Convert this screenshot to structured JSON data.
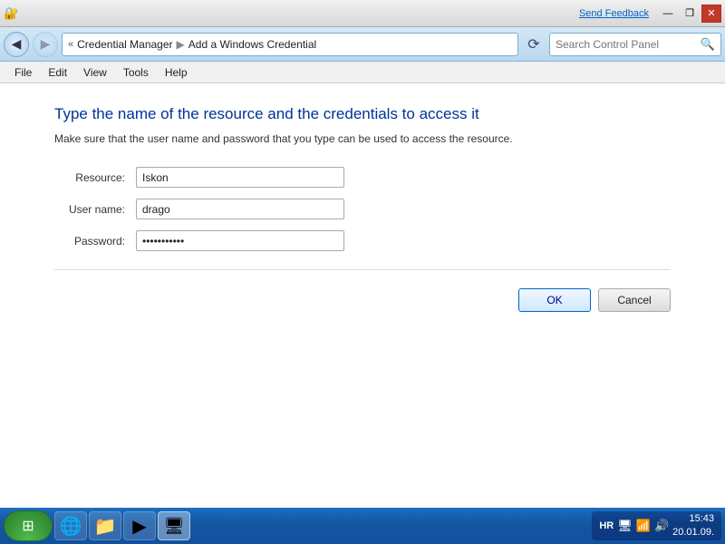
{
  "titlebar": {
    "send_feedback": "Send Feedback",
    "min_btn": "—",
    "restore_btn": "❐",
    "close_btn": "✕"
  },
  "navbar": {
    "back_title": "Back",
    "forward_title": "Forward",
    "address": {
      "chevrons": "«",
      "breadcrumb": "Credential Manager",
      "sep": "▶",
      "page": "Add a Windows Credential"
    },
    "refresh_icon": "⟳",
    "search_placeholder": "Search Control Panel",
    "search_icon": "🔍"
  },
  "menubar": {
    "items": [
      {
        "label": "File"
      },
      {
        "label": "Edit"
      },
      {
        "label": "View"
      },
      {
        "label": "Tools"
      },
      {
        "label": "Help"
      }
    ]
  },
  "form": {
    "title": "Type the name of the resource and the credentials to access it",
    "subtitle": "Make sure that the user name and password that you type can be used to access the resource.",
    "resource_label": "Resource:",
    "resource_value": "Iskon",
    "username_label": "User name:",
    "username_value": "drago",
    "password_label": "Password:",
    "password_value": "••••••••••••",
    "ok_label": "OK",
    "cancel_label": "Cancel"
  },
  "taskbar": {
    "start_icon": "⊞",
    "ie_icon": "🌐",
    "explorer_icon": "📁",
    "media_icon": "▶",
    "network_icon": "🖥",
    "tray_lang": "HR",
    "tray_monitor": "🖥",
    "tray_network": "📶",
    "tray_volume": "🔊",
    "time": "15:43",
    "date": "20.01.09."
  }
}
